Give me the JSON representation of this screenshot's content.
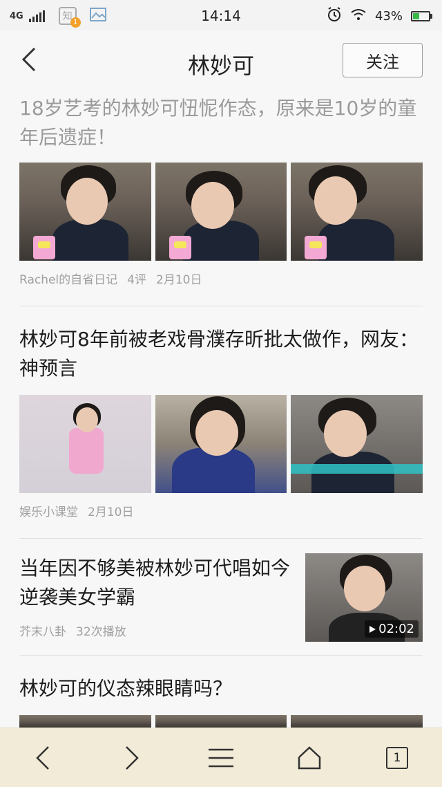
{
  "status_bar": {
    "network": "4G",
    "app_icon_text": "知",
    "notification_count": "1",
    "time": "14:14",
    "battery_percent": "43%",
    "battery_level": 0.43
  },
  "header": {
    "title": "林妙可",
    "follow_label": "关注"
  },
  "articles": [
    {
      "title": "18岁艺考的林妙可忸怩作态，原来是10岁的童年后遗症！",
      "source": "Rachel的自省日记",
      "comments": "4评",
      "date": "2月10日",
      "read": true
    },
    {
      "title": "林妙可8年前被老戏骨濮存昕批太做作，网友：神预言",
      "source": "娱乐小课堂",
      "date": "2月10日",
      "read": false
    },
    {
      "title": "当年因不够美被林妙可代唱如今逆袭美女学霸",
      "source": "芥末八卦",
      "plays": "32次播放",
      "duration": "02:02"
    },
    {
      "title": "林妙可的仪态辣眼睛吗？"
    }
  ],
  "bottom_nav": {
    "tab_count": "1"
  }
}
